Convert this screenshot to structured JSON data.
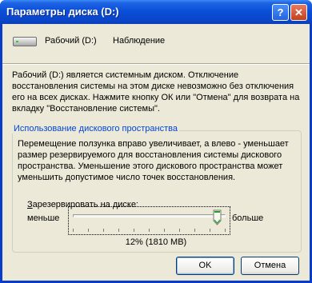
{
  "window": {
    "title": "Параметры диска (D:)",
    "help_button": "?",
    "close_button": "✕"
  },
  "drive": {
    "name": "Рабочий (D:)",
    "status": "Наблюдение",
    "icon": "hard-drive-icon"
  },
  "description": "Рабочий (D:) является системным диском. Отключение восстановления системы на этом диске невозможно без отключения его на всех дисках. Нажмите кнопку ОК или \"Отмена\" для возврата на вкладку \"Восстановление системы\".",
  "disk_usage": {
    "group_title": "Использование дискового пространства",
    "description": "Перемещение ползунка вправо увеличивает, а влево - уменьшает размер резервируемого для восстановления системы дискового пространства. Уменьшение этого дискового пространства может уменьшить допустимое число точек восстановления.",
    "reserve_label_underlined": "З",
    "reserve_label_rest": "арезервировать на диске:",
    "min_label": "меньше",
    "max_label": "больше",
    "slider_position_fraction": 0.97,
    "percent_text": "12% (1810 MB)"
  },
  "buttons": {
    "ok": "OK",
    "cancel": "Отмена"
  },
  "colors": {
    "title_bar": "#0a4fd8",
    "dialog_background": "#ece9d8",
    "group_title": "#0046d5",
    "close_button": "#c3401e",
    "thumb_accent": "#21a121"
  }
}
